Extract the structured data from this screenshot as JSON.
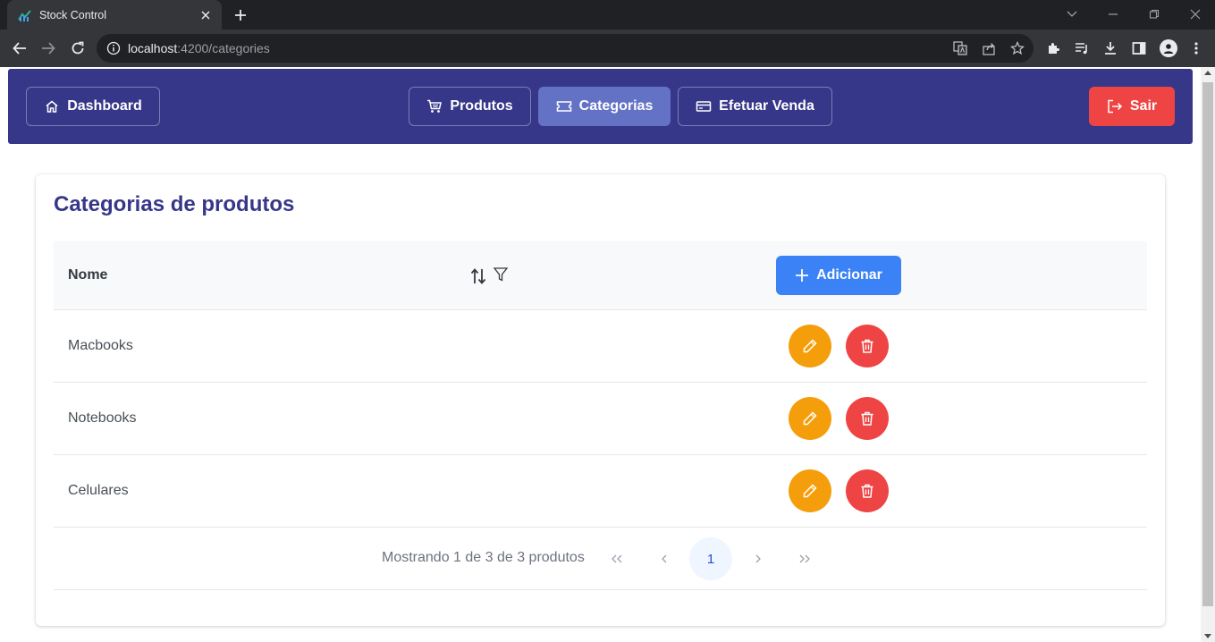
{
  "browser": {
    "tab_title": "Stock Control",
    "url_host": "localhost",
    "url_path": ":4200/categories"
  },
  "nav": {
    "dashboard": "Dashboard",
    "produtos": "Produtos",
    "categorias": "Categorias",
    "efetuar_venda": "Efetuar Venda",
    "sair": "Sair"
  },
  "page": {
    "title": "Categorias de produtos"
  },
  "table": {
    "column_name": "Nome",
    "add_label": "Adicionar",
    "rows": [
      {
        "name": "Macbooks"
      },
      {
        "name": "Notebooks"
      },
      {
        "name": "Celulares"
      }
    ]
  },
  "paginator": {
    "report": "Mostrando 1 de 3 de 3 produtos",
    "current_page": "1"
  },
  "colors": {
    "navbar": "#37378a",
    "active_nav": "#6472c6",
    "logout": "#ef4444",
    "primary": "#3b82f6",
    "edit": "#f59e0b",
    "delete": "#ef4444"
  }
}
